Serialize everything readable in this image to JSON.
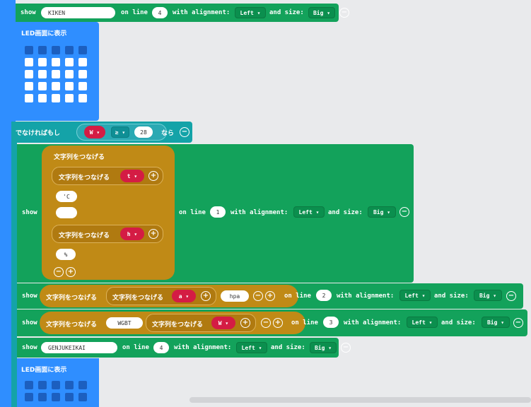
{
  "blocks": {
    "show_kw": "show",
    "on_line": "on line",
    "with_align": "with alignment:",
    "and_size": "and size:",
    "align_val": "Left",
    "size_val": "Big",
    "minus": "−",
    "plus": "+",
    "dropdown_arrow": "▾"
  },
  "row1": {
    "text": "KIKEN",
    "line": "4"
  },
  "led1": {
    "label": "LED画面に表示"
  },
  "elseif": {
    "label": "でなければもし",
    "var": "W",
    "op": "≥",
    "value": "28",
    "then": "なら"
  },
  "show_line1": {
    "join_outer": "文字列をつなげる",
    "join_inner1": "文字列をつなげる",
    "var_t": "t",
    "str_c": "'C",
    "str_blank": " ",
    "join_inner2": "文字列をつなげる",
    "var_h": "h",
    "str_pct": "%",
    "line": "1"
  },
  "show_line2": {
    "join": "文字列をつなげる",
    "join_inner": "文字列をつなげる",
    "var": "a",
    "str": "hpa",
    "line": "2"
  },
  "show_line3": {
    "join": "文字列をつなげる",
    "str": "WGBT",
    "join_inner": "文字列をつなげる",
    "var": "W",
    "line": "3"
  },
  "row_last": {
    "text": "GENJUKEIKAI",
    "line": "4"
  },
  "led2": {
    "label": "LED画面に表示"
  },
  "icons": [
    "minus-circle-icon",
    "plus-circle-icon",
    "dropdown-arrow-icon"
  ],
  "colors": {
    "green": "#13a25b",
    "blue": "#2f8eff",
    "teal": "#14a3a8",
    "gold": "#c08a16",
    "red": "#d41c44",
    "background": "#e9eaec"
  }
}
